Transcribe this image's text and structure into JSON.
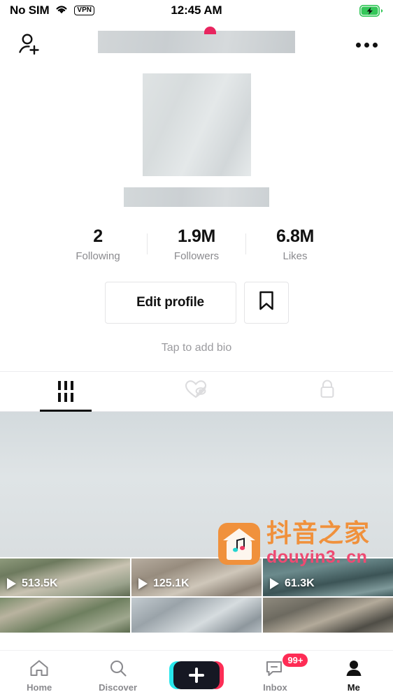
{
  "status_bar": {
    "carrier": "No SIM",
    "wifi_icon": "wifi-icon",
    "vpn_label": "VPN",
    "time": "12:45 AM",
    "battery_icon": "battery-charging-icon",
    "battery_color": "#34c759"
  },
  "header": {
    "add_friend_icon": "add-person-icon",
    "title_redacted": true,
    "notification_dot_color": "#e8255f",
    "more_icon": "more-options-icon"
  },
  "profile": {
    "avatar_redacted": true,
    "username_redacted": true,
    "bio_placeholder": "Tap to add bio",
    "stats": [
      {
        "value": "2",
        "label": "Following"
      },
      {
        "value": "1.9M",
        "label": "Followers"
      },
      {
        "value": "6.8M",
        "label": "Likes"
      }
    ],
    "edit_profile_label": "Edit profile",
    "bookmark_icon": "bookmark-icon"
  },
  "content_tabs": [
    {
      "icon": "grid-icon",
      "name": "posts",
      "active": true
    },
    {
      "icon": "heart-hidden-icon",
      "name": "liked-hidden",
      "active": false
    },
    {
      "icon": "lock-icon",
      "name": "private",
      "active": false
    }
  ],
  "videos": {
    "featured": {
      "views": ""
    },
    "row_one": [
      {
        "views": "513.5K"
      },
      {
        "views": "125.1K"
      },
      {
        "views": "61.3K"
      }
    ],
    "row_two": [
      {
        "views": ""
      },
      {
        "views": ""
      },
      {
        "views": ""
      }
    ]
  },
  "watermark": {
    "logo_icon": "music-house-icon",
    "brand_cn": "抖音之家",
    "url": "douyin3. cn",
    "brand_color": "#f0913c",
    "url_color": "#ee4a72"
  },
  "bottom_nav": [
    {
      "label": "Home",
      "icon": "home-icon",
      "active": false
    },
    {
      "label": "Discover",
      "icon": "search-icon",
      "active": false
    },
    {
      "label": "",
      "icon": "create-plus-icon",
      "active": false
    },
    {
      "label": "Inbox",
      "icon": "message-icon",
      "active": false,
      "badge": "99+"
    },
    {
      "label": "Me",
      "icon": "person-filled-icon",
      "active": true
    }
  ]
}
